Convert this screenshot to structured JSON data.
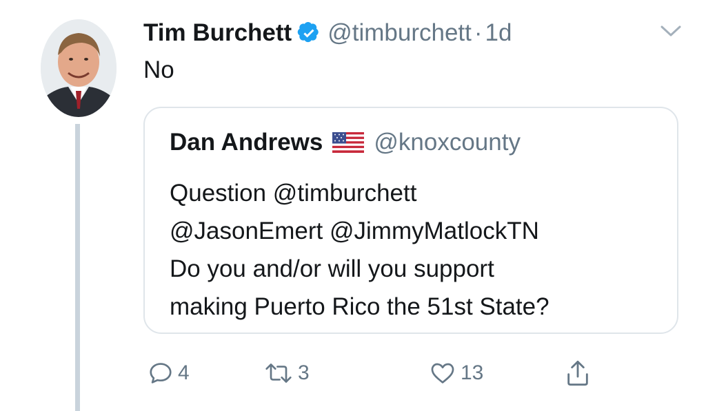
{
  "tweet": {
    "author_name": "Tim Burchett",
    "author_handle": "@timburchett",
    "separator": "·",
    "time": "1d",
    "text": "No"
  },
  "quoted_tweet": {
    "author_name": "Dan Andrews",
    "author_handle": "@knoxcounty",
    "lines": [
      "Question  @timburchett",
      "@JasonEmert @JimmyMatlockTN",
      "Do you and/or will you support",
      "making Puerto Rico the 51st State?"
    ]
  },
  "actions": {
    "reply_count": "4",
    "retweet_count": "3",
    "like_count": "13"
  },
  "colors": {
    "primary_text": "#14171a",
    "secondary_text": "#657786",
    "verified_blue": "#1da1f2",
    "border": "#dfe5ea",
    "thread_line": "#c9d3dc"
  },
  "icons": [
    "verified-badge-icon",
    "chevron-down-icon",
    "us-flag-icon",
    "reply-icon",
    "retweet-icon",
    "like-icon",
    "share-icon"
  ]
}
